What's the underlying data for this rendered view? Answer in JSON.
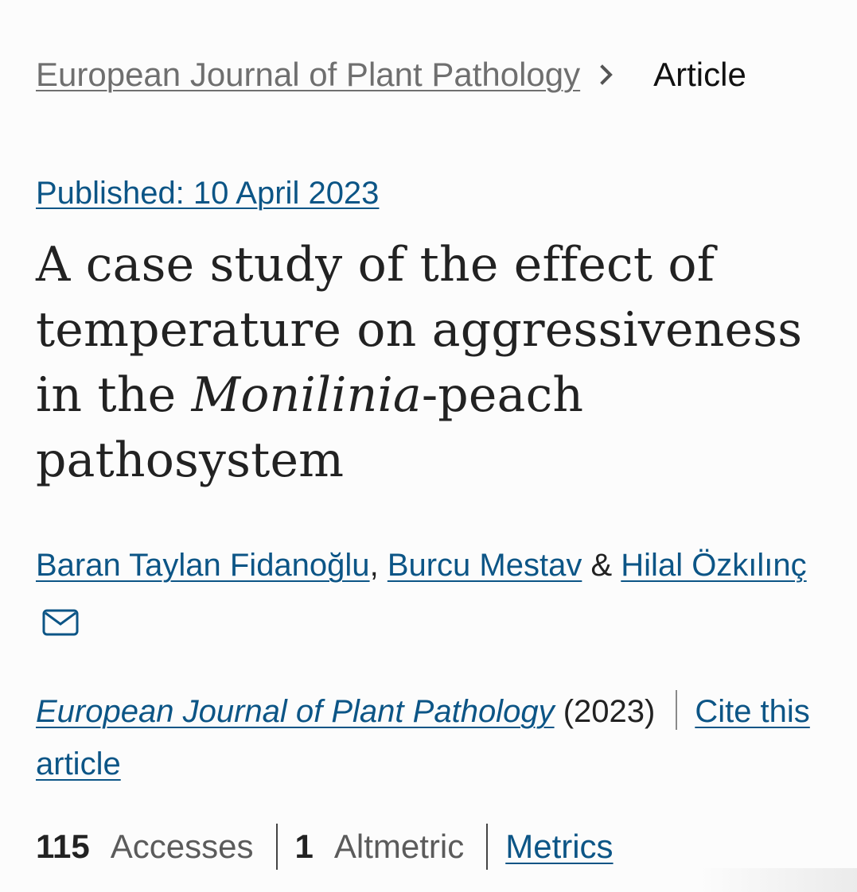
{
  "breadcrumb": {
    "journal": "European Journal of Plant Pathology",
    "separator_icon": "chevron-right-icon",
    "current": "Article"
  },
  "article": {
    "published": "Published: 10 April 2023",
    "title_part1": "A case study of the effect of temperature on aggressiveness in the ",
    "title_italic": "Monilinia",
    "title_part2": "-peach pathosystem"
  },
  "authors": {
    "list": [
      "Baran Taylan Fidanoğlu",
      "Burcu Mestav",
      "Hilal Özkılınç"
    ],
    "comma": ",",
    "ampersand": "&",
    "contact_icon": "mail-icon"
  },
  "citation": {
    "journal": "European Journal of Plant Pathology",
    "year": "(2023)",
    "cite_label": "Cite this article"
  },
  "metrics": {
    "accesses_count": "115",
    "accesses_label": "Accesses",
    "altmetric_count": "1",
    "altmetric_label": "Altmetric",
    "metrics_link": "Metrics"
  },
  "colors": {
    "link": "#0c5586",
    "text": "#222222",
    "muted": "#6f6f6f",
    "background": "#fcfcfc"
  }
}
